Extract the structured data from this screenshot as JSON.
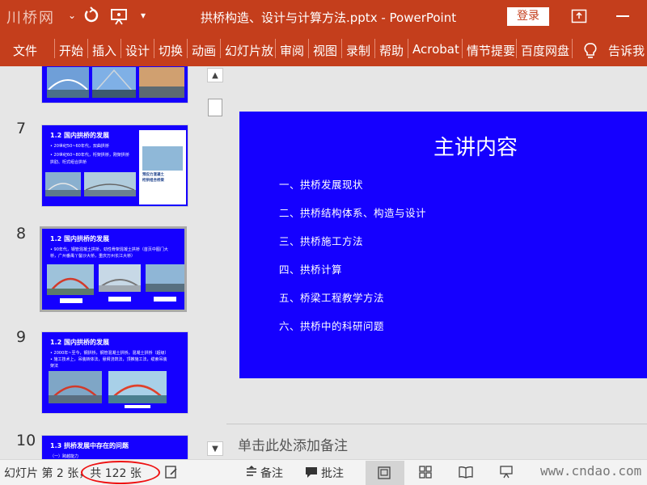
{
  "titlebar": {
    "logo": "川桥网",
    "doc_title": "拱桥构造、设计与计算方法.pptx  -  PowerPoint",
    "login": "登录"
  },
  "ribbon": {
    "tabs": [
      "文件",
      "开始",
      "插入",
      "设计",
      "切换",
      "动画",
      "幻灯片放",
      "审阅",
      "视图",
      "录制",
      "帮助",
      "Acrobat",
      "情节提要",
      "百度网盘",
      "告诉我"
    ]
  },
  "thumbnails": [
    {
      "num": "7",
      "title": "1.2  国内拱桥的发展",
      "lines": [
        "• 20世纪50~60年代，双曲拱桥",
        "• 20世纪60~80年代，桁架拱桥，刚架拱桥",
        "  拱肋、桁式组合拱桥"
      ],
      "book_lines": [
        "预应力混凝土",
        "桁拱组合桥梁"
      ]
    },
    {
      "num": "8",
      "title": "1.2  国内拱桥的发展",
      "lines": [
        "• 90年代，钢管混凝土拱桥，劲性骨架混凝土拱桥（首页中图门大",
        "  桥，广州番禺丫髻沙大桥，重庆万州长江大桥）"
      ]
    },
    {
      "num": "9",
      "title": "1.2  国内拱桥的发展",
      "lines": [
        "• 2000年~至今，钢拱桥，钢管混凝土拱桥，混凝土拱桥（超级）",
        "• 施工技术上，吊装转体法，悬臂浇筑法，顶推施工法，缆索吊装",
        "  架法"
      ]
    },
    {
      "num": "10",
      "title": "1.3  拱桥发展中存在的问题",
      "lines": [
        "（一）跨越能力"
      ]
    }
  ],
  "main_slide": {
    "title": "主讲内容",
    "items": [
      "一、拱桥发展现状",
      "二、拱桥结构体系、构造与设计",
      "三、拱桥施工方法",
      "四、拱桥计算",
      "五、桥梁工程教学方法",
      "六、拱桥中的科研问题"
    ]
  },
  "notes": {
    "placeholder": "单击此处添加备注"
  },
  "status": {
    "slide_counter": "幻灯片 第 2 张，共 122 张",
    "notes_label": "备注",
    "comments_label": "批注",
    "watermark": "www.cndao.com"
  },
  "colors": {
    "accent": "#c43e1c",
    "slide_blue": "#1500ff",
    "highlight": "#ee1111"
  }
}
